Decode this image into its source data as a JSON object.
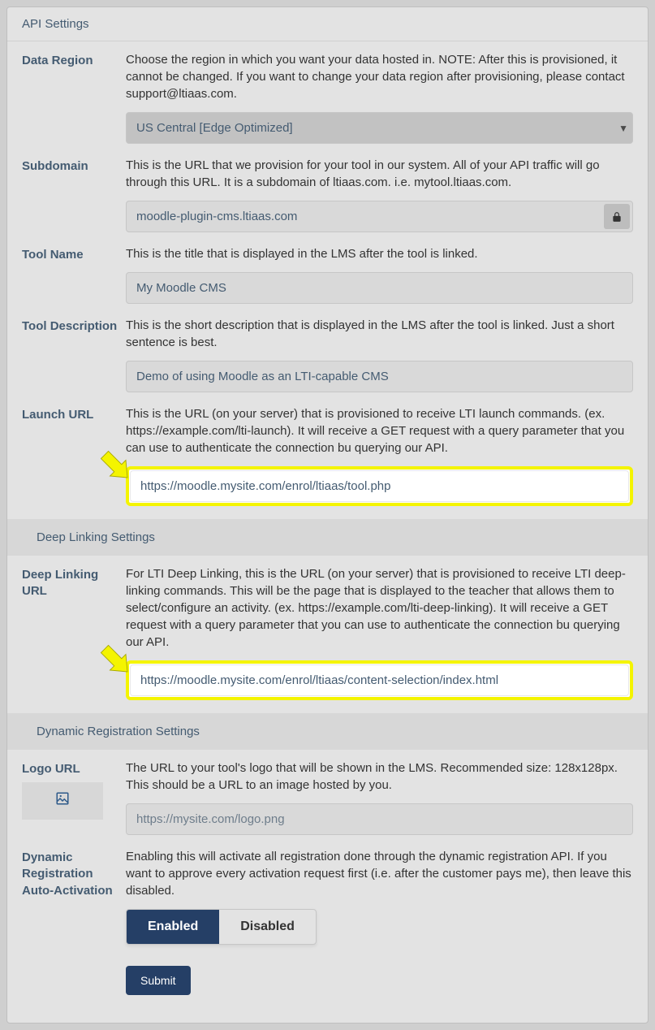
{
  "panel": {
    "title": "API Settings"
  },
  "dataRegion": {
    "label": "Data Region",
    "description": "Choose the region in which you want your data hosted in. NOTE: After this is provisioned, it cannot be changed. If you want to change your data region after provisioning, please contact support@ltiaas.com.",
    "selected": "US Central [Edge Optimized]"
  },
  "subdomain": {
    "label": "Subdomain",
    "description": "This is the URL that we provision for your tool in our system. All of your API traffic will go through this URL. It is a subdomain of ltiaas.com. i.e. mytool.ltiaas.com.",
    "value": "moodle-plugin-cms.ltiaas.com"
  },
  "toolName": {
    "label": "Tool Name",
    "description": "This is the title that is displayed in the LMS after the tool is linked.",
    "value": "My Moodle CMS"
  },
  "toolDescription": {
    "label": "Tool Description",
    "description": "This is the short description that is displayed in the LMS after the tool is linked. Just a short sentence is best.",
    "value": "Demo of using Moodle as an LTI-capable CMS"
  },
  "launchUrl": {
    "label": "Launch URL",
    "description": "This is the URL (on your server) that is provisioned to receive LTI launch commands. (ex. https://example.com/lti-launch). It will receive a GET request with a query parameter that you can use to authenticate the connection bu querying our API.",
    "value": "https://moodle.mysite.com/enrol/ltiaas/tool.php"
  },
  "deepLinkingSection": "Deep Linking Settings",
  "deepLinkingUrl": {
    "label": "Deep Linking URL",
    "description": "For LTI Deep Linking, this is the URL (on your server) that is provisioned to receive LTI deep-linking commands. This will be the page that is displayed to the teacher that allows them to select/configure an activity. (ex. https://example.com/lti-deep-linking). It will receive a GET request with a query parameter that you can use to authenticate the connection bu querying our API.",
    "value": "https://moodle.mysite.com/enrol/ltiaas/content-selection/index.html"
  },
  "dynamicRegSection": "Dynamic Registration Settings",
  "logoUrl": {
    "label": "Logo URL",
    "description": "The URL to your tool's logo that will be shown in the LMS. Recommended size: 128x128px. This should be a URL to an image hosted by you.",
    "placeholder": "https://mysite.com/logo.png"
  },
  "autoActivation": {
    "label": "Dynamic Registration Auto-Activation",
    "description": "Enabling this will activate all registration done through the dynamic registration API. If you want to approve every activation request first (i.e. after the customer pays me), then leave this disabled.",
    "enabled": "Enabled",
    "disabled": "Disabled"
  },
  "submit": "Submit",
  "colors": {
    "accent": "#253f66",
    "highlight": "#f4f400"
  }
}
